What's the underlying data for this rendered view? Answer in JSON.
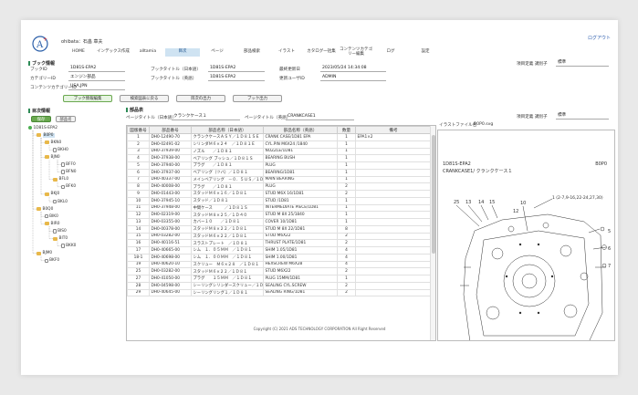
{
  "header": {
    "user": "ohibata：石畠 章夫",
    "logout": "ログアウト"
  },
  "nav": [
    {
      "label": "HOME"
    },
    {
      "label": "インデックス作成"
    },
    {
      "label": "alltamia"
    },
    {
      "label": "目次",
      "active": true
    },
    {
      "label": "ページ"
    },
    {
      "label": "部品検索"
    },
    {
      "label": "イラスト"
    },
    {
      "label": "カタログ一括集"
    },
    {
      "label": "コンテンツカテゴリー編集"
    },
    {
      "label": "ログ"
    },
    {
      "label": "設定"
    }
  ],
  "book_info": {
    "title": "ブック情報",
    "fields": {
      "book_id_label": "ブックID",
      "book_id": "1D81S-EPA2",
      "category_id_label": "カテゴリーID",
      "category_id": "エンジン部品",
      "content_category_label": "コンテンツカテゴリーID",
      "content_category": "USA,JPN",
      "book_title_jp_label": "ブックタイトル（日本語）",
      "book_title_jp": "1D81S-EPA2",
      "book_title_en_label": "ブックタイトル（英語）",
      "book_title_en": "1D81S-EPA2",
      "updated_label": "最終更新日",
      "updated": "2023/05/24 14:34:08",
      "updated_user_label": "更新ユーザID",
      "updated_user": "ADMIN",
      "item_label": "項目定義 識別子",
      "item_value": "標準"
    },
    "buttons": [
      "ブック情報編集",
      "検索図表に戻る",
      "目次の出力",
      "ブック出力"
    ]
  },
  "toc": {
    "title": "目次情報",
    "buttons": [
      "保存",
      "部品名"
    ],
    "nodes": [
      {
        "label": "1D81S-EPA2",
        "type": "root",
        "level": 0
      },
      {
        "label": "B0P0",
        "type": "folder",
        "level": 1,
        "selected": true
      },
      {
        "label": "BKN0",
        "type": "folder",
        "level": 2
      },
      {
        "label": "BKH0",
        "type": "doc",
        "level": 3
      },
      {
        "label": "BJN0",
        "type": "folder",
        "level": 2
      },
      {
        "label": "BFF0",
        "type": "doc",
        "level": 4
      },
      {
        "label": "BFN0",
        "type": "doc",
        "level": 4
      },
      {
        "label": "BFL0",
        "type": "folder",
        "level": 3
      },
      {
        "label": "BFK0",
        "type": "doc",
        "level": 4
      },
      {
        "label": "BKJ0",
        "type": "folder",
        "level": 2
      },
      {
        "label": "BKL0",
        "type": "doc",
        "level": 3
      },
      {
        "label": "B0Q0",
        "type": "folder",
        "level": 1
      },
      {
        "label": "BIK0",
        "type": "doc",
        "level": 2
      },
      {
        "label": "BIR0",
        "type": "folder",
        "level": 2
      },
      {
        "label": "BIS0",
        "type": "doc",
        "level": 3
      },
      {
        "label": "BIT0",
        "type": "folder",
        "level": 3
      },
      {
        "label": "BKK0",
        "type": "doc",
        "level": 4
      },
      {
        "label": "BJM0",
        "type": "folder",
        "level": 1
      },
      {
        "label": "BKF0",
        "type": "doc",
        "level": 2
      }
    ]
  },
  "parts": {
    "title": "部品表",
    "page_title_jp_label": "ページタイトル（日本語）",
    "page_title_jp": "クランクケース１",
    "page_title_en_label": "ページタイトル（英語）",
    "page_title_en": "CRANKCASE1",
    "columns": [
      "図版番号",
      "部品番号",
      "部品名称（日本語）",
      "部品名称（英語）",
      "数量",
      "備考"
    ],
    "rows": [
      [
        "1",
        "DH0-12490-70",
        "クランクケースＡＳＹ／１Ｄ８１ＳＥ",
        "CRANK CASE/1D81 EPA",
        "1",
        "EPA1×2"
      ],
      [
        "2",
        "DH0-02491-02",
        "シリンダＭ６×２４　／１Ｄ８１Ｅ",
        "CYL.PIN M6X24 /1840",
        "1",
        ""
      ],
      [
        "3",
        "DH0-37939-00",
        "ノズル　　／１Ｄ８１",
        "NOZZLE/1D81",
        "1",
        ""
      ],
      [
        "4",
        "DH0-37938-00",
        "ベアリング ブッシュ／１Ｄ８１Ｓ",
        "BEARING BUSH",
        "1",
        ""
      ],
      [
        "5",
        "DH0-37940-00",
        "プラグ　　／１Ｄ８１",
        "PLUG",
        "1",
        ""
      ],
      [
        "6",
        "DH0-37937-00",
        "ベアリング（ツバ）／１Ｄ８１",
        "BEARING/1D81",
        "1",
        ""
      ],
      [
        "7",
        "DH0-40337-00",
        "メインベアリング　－０．５ＵＳ／１Ｄ",
        "MAIN BEARING",
        "1",
        ""
      ],
      [
        "8",
        "DH0-40008-00",
        "プラグ　　／１Ｄ８１",
        "PLUG",
        "2",
        ""
      ],
      [
        "9",
        "DH0-01443-00",
        "スタッドＭ６×１６／１Ｄ８１",
        "STUD M6X 16/1D81",
        "2",
        ""
      ],
      [
        "10",
        "DH0-37945-10",
        "スタッド／１Ｄ８１",
        "STUD /1D81",
        "1",
        ""
      ],
      [
        "11",
        "DH0-37948-00",
        "中間ケース　　　／１Ｄ８１Ｓ",
        "INTERMEDIATE PIECE/1D81",
        "1",
        ""
      ],
      [
        "12",
        "DH0-02319-00",
        "スタッドＭ８×２５／１Ｄ４０",
        "STUD M 8X 25/1840",
        "1",
        ""
      ],
      [
        "13",
        "DH0-03355-00",
        "カバー１０　　／１Ｄ８１",
        "COVER 10/1D81",
        "1",
        ""
      ],
      [
        "14",
        "DH0-00378-00",
        "スタッドＭ８×２２／１Ｄ８１",
        "STUD M 8X 22/1D81",
        "8",
        ""
      ],
      [
        "15",
        "DH0-03282-00",
        "スタッドＭ６×２２／１Ｄ８１",
        "STUD M6X22",
        "2",
        ""
      ],
      [
        "16",
        "DH0-40116-51",
        "スラストプレート　／１Ｄ８１",
        "THRUST PLATE/1D81",
        "2",
        ""
      ],
      [
        "17",
        "DH0-40665-00",
        "シム　１．０５ＭＭ　／１Ｄ８１",
        "SHIM 1.05/1D81",
        "4",
        ""
      ],
      [
        "18-1",
        "DH0-40698-00",
        "シム　１．００ＭＭ　／１Ｄ８１",
        "SHIM 1.00/1D81",
        "4",
        ""
      ],
      [
        "19",
        "DH0-40620-10",
        "スクリュー　Ｍ６×２８　／１Ｄ８１",
        "HEXSCREW M6X28",
        "4",
        ""
      ],
      [
        "25",
        "DH0-03282-00",
        "スタッドＭ６×２２／１Ｄ８１",
        "STUD M6X22",
        "2",
        ""
      ],
      [
        "27",
        "DH0-41050-00",
        "プラグ　　１５ＭＭ　／１Ｄ８１",
        "PLUG 15MM/1D81",
        "1",
        ""
      ],
      [
        "28",
        "DH0-04598-00",
        "シーリングシリンダースクリュー／１Ｄ８",
        "SEALING CYL.SCREW",
        "2",
        ""
      ],
      [
        "29",
        "DH0-40645-00",
        "シーリングリング１／１Ｄ８１",
        "SEALING RING/1D81",
        "2",
        ""
      ]
    ]
  },
  "illustration": {
    "file_label": "イラストファイル名",
    "file_name": "B0P0.svg",
    "item_label": "項目定義 識別子",
    "item_value": "標準",
    "caption_line1": "1D81S-EPA2",
    "caption_line2": "CRANKCASE1/ クランクケース１",
    "code": "B0P0",
    "callouts": [
      "25",
      "13",
      "14",
      "15",
      "10",
      "1 (2-7,9-16,22-24,27,30)",
      "12",
      "5",
      "6",
      "7"
    ]
  },
  "footer": {
    "copyright": "Copyright (C) 2021 ADS TECHNOLOGY CORPORATION All Right Reserved"
  }
}
